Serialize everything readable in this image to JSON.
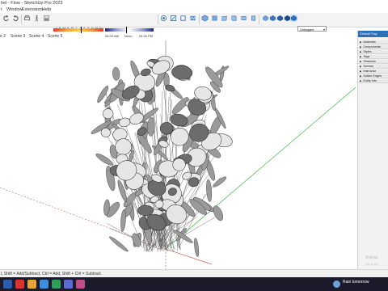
{
  "window": {
    "title": "hel - Flow - SketchUp Pro 2023"
  },
  "menu": [
    "t",
    "Window",
    "Extensions",
    "Help"
  ],
  "shadow_settings": {
    "months": [
      "J",
      "F",
      "M",
      "A",
      "M",
      "J",
      "J",
      "A",
      "S",
      "O",
      "N",
      "D"
    ],
    "time_start": "06:29 AM",
    "time_noon": "Noon",
    "time_end": "04:30 PM"
  },
  "toolbar_icons": [
    "rotate-left-icon",
    "rotate-right-icon",
    "print-icon",
    "walk-icon",
    "shadow-icon",
    "fog-icon",
    "section-icon",
    "box-icon",
    "textures-icon",
    "iso-icon",
    "top-icon",
    "front-icon",
    "right-icon",
    "back-icon",
    "left-icon",
    "xray-icon",
    "wireframe-icon",
    "hidden-line-icon",
    "shaded-icon",
    "textured-icon",
    "monochrome-icon"
  ],
  "tag_selector": {
    "value": "Untagged"
  },
  "scene_tabs": [
    "e 2",
    "Scene 3",
    "Scene 4",
    "Scene 5"
  ],
  "tray": {
    "title": "Default Tray",
    "panels": [
      "Materials",
      "Components",
      "Styles",
      "Tags",
      "Shadows",
      "Scenes",
      "Instructor",
      "Soften Edges",
      "Entity Info"
    ]
  },
  "activation": {
    "line1": "Activat",
    "line2": "Go to Se"
  },
  "status": {
    "message": "l, Shift = Add/Subtract, Ctrl = Add, Shift + Ctrl = Subtract."
  },
  "taskbar": {
    "weather": "Rain tomorrow"
  },
  "colors": {
    "axis_green": "#22aa22",
    "axis_red": "#c0392b",
    "tray_header": "#2f6fb8",
    "taskbar": "#1b1b2b"
  }
}
